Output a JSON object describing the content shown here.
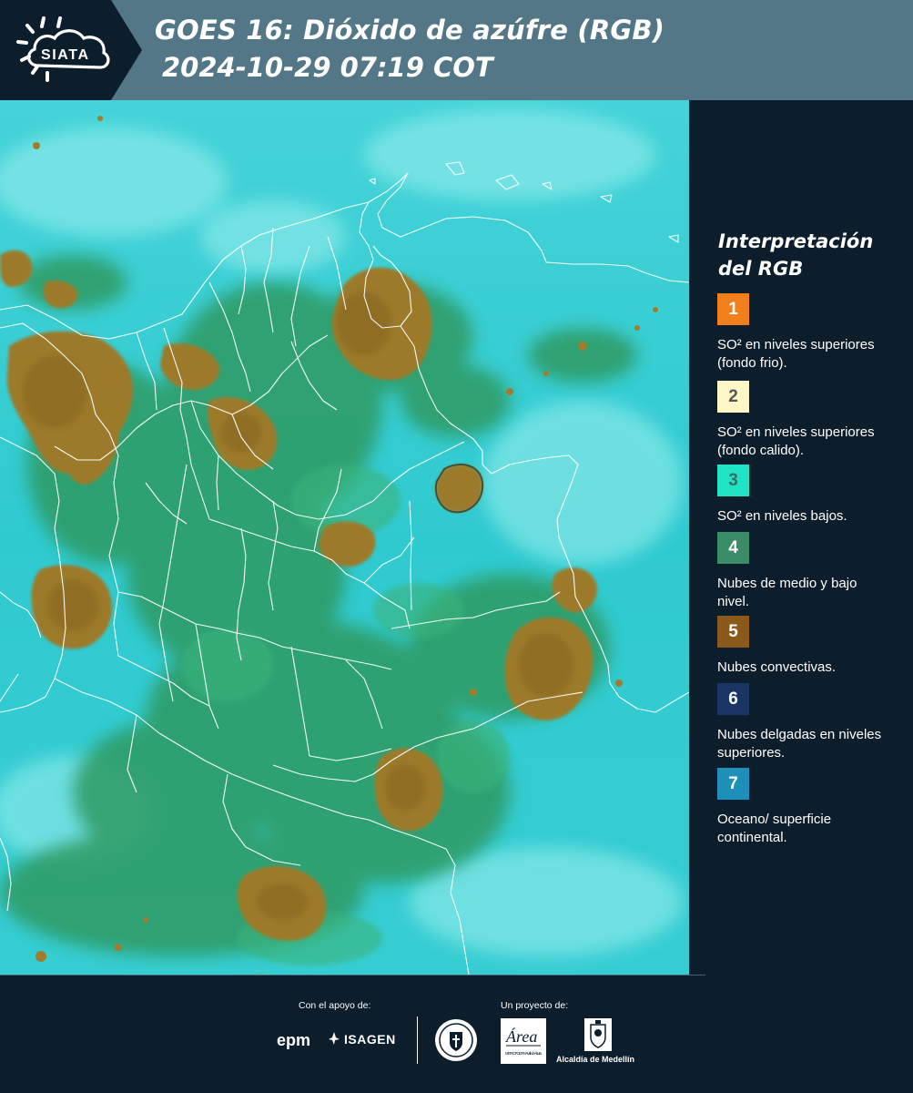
{
  "header": {
    "title": "GOES 16: Dióxido de azúfre (RGB)",
    "subtitle": "2024-10-29 07:19 COT",
    "logo_text": "SIATA"
  },
  "colors": {
    "background": "#0c1e2c",
    "header_band": "#537787",
    "map_base": "#27c9cf",
    "vegetation_green": "#2f9a62",
    "convective_brown": "#9c7a2c",
    "border_lines": "#ffffff"
  },
  "map": {
    "description_icon": "satellite-rgb-map"
  },
  "legend": {
    "title": "Interpretación del RGB",
    "items": [
      {
        "number": "1",
        "color": "#f07f1c",
        "number_color": "#ffffff",
        "text": "SO² en niveles superiores (fondo frio)."
      },
      {
        "number": "2",
        "color": "#fff8c6",
        "number_color": "#555555",
        "text": "SO² en niveles superiores (fondo calido)."
      },
      {
        "number": "3",
        "color": "#1fe3c2",
        "number_color": "#3a6a6a",
        "text": "SO² en niveles bajos."
      },
      {
        "number": "4",
        "color": "#3a8c66",
        "number_color": "#ffffff",
        "text": "Nubes de medio y bajo nivel."
      },
      {
        "number": "5",
        "color": "#8b5a1b",
        "number_color": "#ffffff",
        "text": "Nubes convectivas."
      },
      {
        "number": "6",
        "color": "#1a3564",
        "number_color": "#ffffff",
        "text": "Nubes delgadas en niveles superiores."
      },
      {
        "number": "7",
        "color": "#1d8fb8",
        "number_color": "#ffffff",
        "text": "Oceano/ superficie continental."
      }
    ]
  },
  "footer": {
    "support_label": "Con el apoyo de:",
    "project_label": "Un proyecto de:",
    "epm": "epm",
    "isagen": "ISAGEN",
    "area_text": "Área",
    "area_sub": "METROPOLITANA Valle de Aburrá",
    "alcaldia": "Alcaldía de Medellín"
  }
}
